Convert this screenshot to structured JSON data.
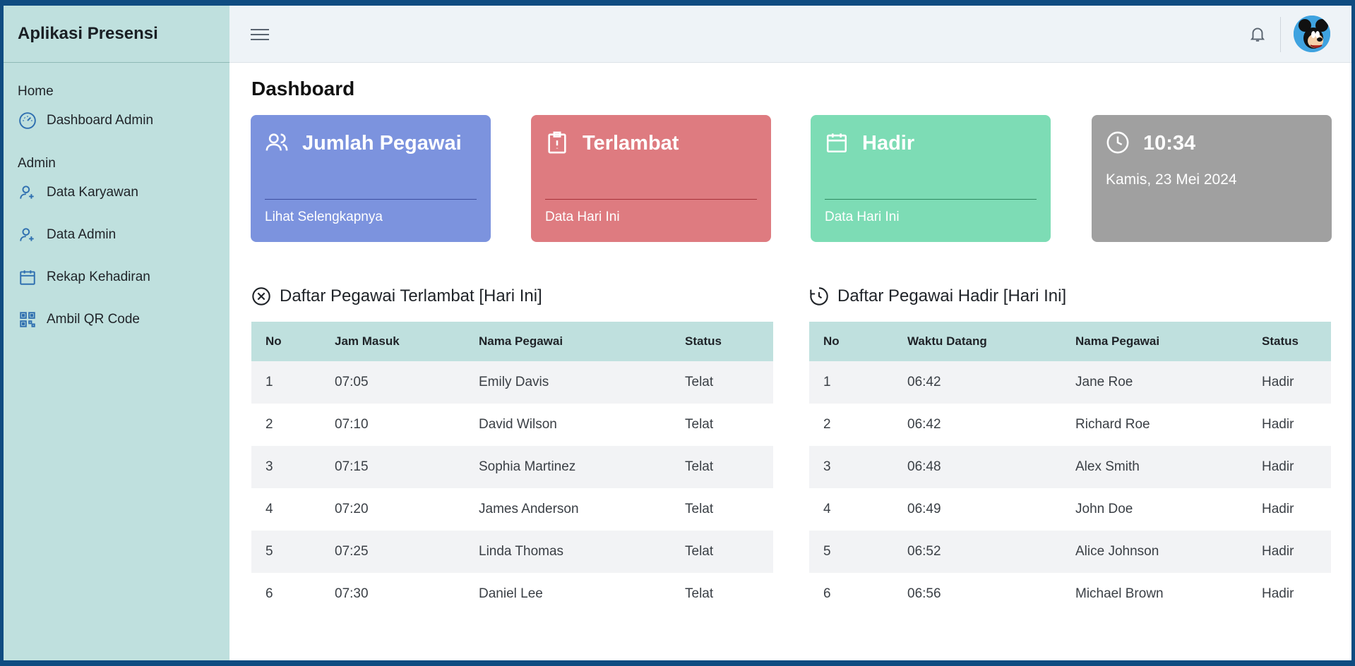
{
  "app": {
    "title": "Aplikasi Presensi"
  },
  "sidebar": {
    "section_home": "Home",
    "section_admin": "Admin",
    "items": [
      {
        "label": "Dashboard Admin",
        "icon": "dashboard-gauge-icon"
      },
      {
        "label": "Data Karyawan",
        "icon": "user-add-icon"
      },
      {
        "label": "Data Admin",
        "icon": "user-add-icon"
      },
      {
        "label": "Rekap Kehadiran",
        "icon": "calendar-icon"
      },
      {
        "label": "Ambil QR Code",
        "icon": "qr-code-icon"
      }
    ]
  },
  "topbar": {
    "menu_icon": "hamburger-icon",
    "notification_icon": "bell-icon",
    "avatar": "mickey-avatar"
  },
  "page": {
    "title": "Dashboard"
  },
  "cards": {
    "employees": {
      "title": "Jumlah Pegawai",
      "footer": "Lihat Selengkapnya",
      "color": "#7c93de",
      "icon": "users-icon"
    },
    "late": {
      "title": "Terlambat",
      "footer": "Data Hari Ini",
      "color": "#de7b80",
      "icon": "clipboard-alert-icon"
    },
    "present": {
      "title": "Hadir",
      "footer": "Data Hari Ini",
      "color": "#7ddcb5",
      "icon": "calendar-icon"
    },
    "clock": {
      "time": "10:34",
      "date": "Kamis, 23 Mei 2024",
      "color": "#a0a0a0",
      "icon": "clock-icon"
    }
  },
  "late_table": {
    "title": "Daftar Pegawai Terlambat [Hari Ini]",
    "icon": "x-circle-icon",
    "headers": [
      "No",
      "Jam Masuk",
      "Nama Pegawai",
      "Status"
    ],
    "rows": [
      [
        "1",
        "07:05",
        "Emily Davis",
        "Telat"
      ],
      [
        "2",
        "07:10",
        "David Wilson",
        "Telat"
      ],
      [
        "3",
        "07:15",
        "Sophia Martinez",
        "Telat"
      ],
      [
        "4",
        "07:20",
        "James Anderson",
        "Telat"
      ],
      [
        "5",
        "07:25",
        "Linda Thomas",
        "Telat"
      ],
      [
        "6",
        "07:30",
        "Daniel Lee",
        "Telat"
      ]
    ]
  },
  "present_table": {
    "title": "Daftar Pegawai Hadir [Hari Ini]",
    "icon": "clock-history-icon",
    "headers": [
      "No",
      "Waktu Datang",
      "Nama Pegawai",
      "Status"
    ],
    "rows": [
      [
        "1",
        "06:42",
        "Jane Roe",
        "Hadir"
      ],
      [
        "2",
        "06:42",
        "Richard Roe",
        "Hadir"
      ],
      [
        "3",
        "06:48",
        "Alex Smith",
        "Hadir"
      ],
      [
        "4",
        "06:49",
        "John Doe",
        "Hadir"
      ],
      [
        "5",
        "06:52",
        "Alice Johnson",
        "Hadir"
      ],
      [
        "6",
        "06:56",
        "Michael Brown",
        "Hadir"
      ]
    ]
  }
}
